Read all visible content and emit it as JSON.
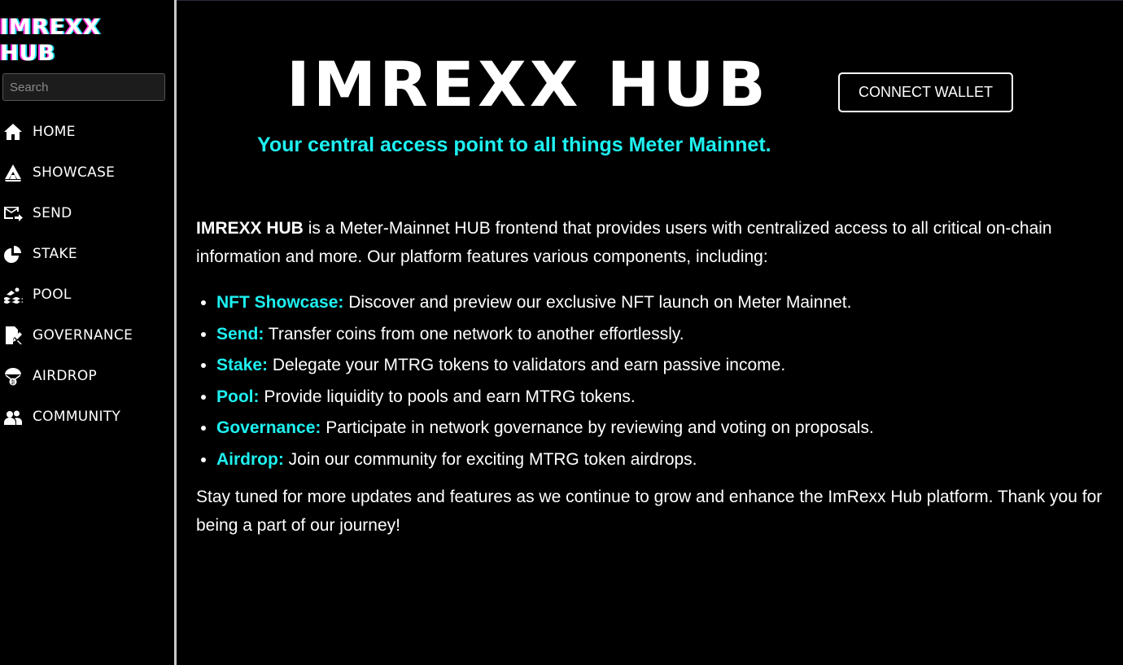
{
  "sidebar": {
    "logo_line1": "IMREXX",
    "logo_line2": "HUB",
    "search_placeholder": "Search",
    "items": [
      {
        "label": "HOME",
        "icon": "home-icon"
      },
      {
        "label": "SHOWCASE",
        "icon": "showcase-icon"
      },
      {
        "label": "SEND",
        "icon": "send-icon"
      },
      {
        "label": "STAKE",
        "icon": "stake-icon"
      },
      {
        "label": "POOL",
        "icon": "pool-icon"
      },
      {
        "label": "GOVERNANCE",
        "icon": "governance-icon"
      },
      {
        "label": "AIRDROP",
        "icon": "airdrop-icon"
      },
      {
        "label": "COMMUNITY",
        "icon": "community-icon"
      }
    ]
  },
  "header": {
    "title": "IMREXX HUB",
    "tagline": "Your central access point to all things Meter Mainnet.",
    "connect_label": "CONNECT WALLET"
  },
  "content": {
    "intro_brand": "IMREXX HUB",
    "intro_text": " is a Meter-Mainnet HUB frontend that provides users with centralized access to all critical on-chain information and more. Our platform features various components, including:",
    "features": [
      {
        "name": "NFT Showcase:",
        "desc": " Discover and preview our exclusive NFT launch on Meter Mainnet."
      },
      {
        "name": "Send:",
        "desc": " Transfer coins from one network to another effortlessly."
      },
      {
        "name": "Stake:",
        "desc": " Delegate your MTRG tokens to validators and earn passive income."
      },
      {
        "name": "Pool:",
        "desc": " Provide liquidity to pools and earn MTRG tokens."
      },
      {
        "name": "Governance:",
        "desc": " Participate in network governance by reviewing and voting on proposals."
      },
      {
        "name": "Airdrop:",
        "desc": " Join our community for exciting MTRG token airdrops."
      }
    ],
    "outro": "Stay tuned for more updates and features as we continue to grow and enhance the ImRexx Hub platform. Thank you for being a part of our journey!"
  },
  "colors": {
    "accent": "#1ef0f0",
    "background": "#000000",
    "logo_glitch_pink": "#ff2bd6",
    "logo_glitch_cyan": "#1ee3f5"
  }
}
